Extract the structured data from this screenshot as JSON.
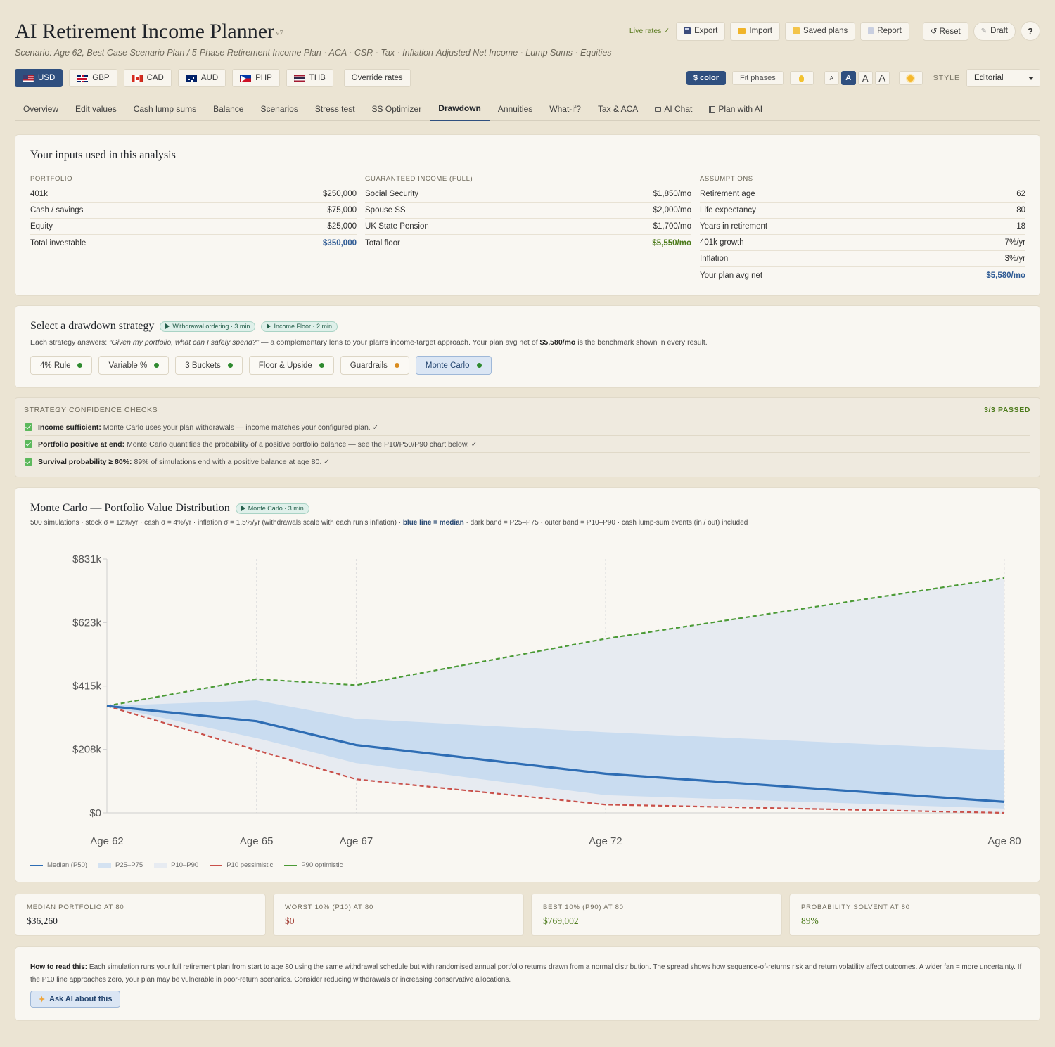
{
  "header": {
    "title": "AI Retirement Income Planner",
    "version": "v7",
    "subtitle": "Scenario: Age 62, Best Case Scenario Plan / 5-Phase Retirement Income Plan · ACA · CSR · Tax · Inflation-Adjusted Net Income · Lump Sums · Equities",
    "live_rates": "Live rates ✓",
    "export_label": "Export",
    "import_label": "Import",
    "saved_plans_label": "Saved plans",
    "report_label": "Report",
    "reset_label": "↺ Reset",
    "draft_label": "Draft",
    "help_label": "?"
  },
  "currencies": [
    {
      "code": "USD",
      "flag": "us"
    },
    {
      "code": "GBP",
      "flag": "gb"
    },
    {
      "code": "CAD",
      "flag": "ca"
    },
    {
      "code": "AUD",
      "flag": "au"
    },
    {
      "code": "PHP",
      "flag": "ph"
    },
    {
      "code": "THB",
      "flag": "th"
    }
  ],
  "override_rates_label": "Override rates",
  "style_controls": {
    "color_label": "$ color",
    "fit_phases_label": "Fit phases",
    "font_sizes": [
      "A",
      "A",
      "A",
      "A"
    ],
    "style_label": "STYLE",
    "style_value": "Editorial"
  },
  "tabs": [
    "Overview",
    "Edit values",
    "Cash lump sums",
    "Balance",
    "Scenarios",
    "Stress test",
    "SS Optimizer",
    "Drawdown",
    "Annuities",
    "What-if?",
    "Tax & ACA",
    "AI Chat",
    "Plan with AI"
  ],
  "inputs": {
    "title": "Your inputs used in this analysis",
    "portfolio": {
      "heading": "PORTFOLIO",
      "rows": [
        {
          "label": "401k",
          "value": "$250,000"
        },
        {
          "label": "Cash / savings",
          "value": "$75,000"
        },
        {
          "label": "Equity",
          "value": "$25,000"
        },
        {
          "label": "Total investable",
          "value": "$350,000"
        }
      ]
    },
    "guaranteed": {
      "heading": "GUARANTEED INCOME (FULL)",
      "rows": [
        {
          "label": "Social Security",
          "value": "$1,850/mo"
        },
        {
          "label": "Spouse SS",
          "value": "$2,000/mo"
        },
        {
          "label": "UK State Pension",
          "value": "$1,700/mo"
        },
        {
          "label": "Total floor",
          "value": "$5,550/mo"
        }
      ]
    },
    "assumptions": {
      "heading": "ASSUMPTIONS",
      "rows": [
        {
          "label": "Retirement age",
          "value": "62"
        },
        {
          "label": "Life expectancy",
          "value": "80"
        },
        {
          "label": "Years in retirement",
          "value": "18"
        },
        {
          "label": "401k growth",
          "value": "7%/yr"
        },
        {
          "label": "Inflation",
          "value": "3%/yr"
        },
        {
          "label": "Your plan avg net",
          "value": "$5,580/mo"
        }
      ]
    }
  },
  "strategy": {
    "title": "Select a drawdown strategy",
    "tag1": "Withdrawal ordering · 3 min",
    "tag2": "Income Floor · 2 min",
    "desc_pre": "Each strategy answers: ",
    "desc_quote": "“Given my portfolio, what can I safely spend?”",
    "desc_mid": " — a complementary lens to your plan's income-target approach. Your plan avg net of ",
    "desc_bold": "$5,580/mo",
    "desc_post": " is the benchmark shown in every result.",
    "options": [
      {
        "label": "4% Rule",
        "status": "green"
      },
      {
        "label": "Variable %",
        "status": "green"
      },
      {
        "label": "3 Buckets",
        "status": "green"
      },
      {
        "label": "Floor & Upside",
        "status": "green"
      },
      {
        "label": "Guardrails",
        "status": "orange"
      },
      {
        "label": "Monte Carlo",
        "status": "green"
      }
    ],
    "selected": "Monte Carlo"
  },
  "checks": {
    "heading": "STRATEGY CONFIDENCE CHECKS",
    "summary": "3/3 PASSED",
    "items": [
      {
        "bold": "Income sufficient:",
        "text": " Monte Carlo uses your plan withdrawals — income matches your configured plan. ✓"
      },
      {
        "bold": "Portfolio positive at end:",
        "text": " Monte Carlo quantifies the probability of a positive portfolio balance — see the P10/P50/P90 chart below. ✓"
      },
      {
        "bold": "Survival probability ≥ 80%:",
        "text": " 89% of simulations end with a positive balance at age 80. ✓"
      }
    ]
  },
  "monte_carlo": {
    "title": "Monte Carlo — Portfolio Value Distribution",
    "tag": "Monte Carlo · 3 min",
    "desc_pre": "500 simulations · stock σ = 12%/yr · cash σ = 4%/yr · inflation σ = 1.5%/yr (withdrawals scale with each run's inflation) · ",
    "desc_bold": "blue line = median",
    "desc_post": " · dark band = P25–P75 · outer band = P10–P90 · cash lump-sum events (in / out) included",
    "legend": [
      "Median (P50)",
      "P25–P75",
      "P10–P90",
      "P10 pessimistic",
      "P90 optimistic"
    ],
    "colors": {
      "median": "#2e6db4",
      "p25_p75": "#c9dcf0",
      "p10_p90": "#e7ebf1",
      "p10": "#c9504a",
      "p90": "#4b9a35"
    }
  },
  "chart_data": {
    "type": "line",
    "x": [
      62,
      65,
      67,
      72,
      80
    ],
    "x_tick_labels": [
      "Age 62",
      "Age 65",
      "Age 67",
      "Age 72",
      "Age 80"
    ],
    "y_tick_labels": [
      "$0",
      "$208k",
      "$415k",
      "$623k",
      "$831k"
    ],
    "y_ticks": [
      0,
      208,
      415,
      623,
      831
    ],
    "ylim": [
      0,
      831
    ],
    "units": "thousands of dollars",
    "series": [
      {
        "name": "Median (P50)",
        "values": [
          350,
          300,
          222,
          128,
          36
        ]
      },
      {
        "name": "P25–P75",
        "lower": [
          350,
          245,
          163,
          58,
          14
        ],
        "upper": [
          350,
          368,
          308,
          264,
          205
        ]
      },
      {
        "name": "P10–P90",
        "lower": [
          350,
          205,
          108,
          28,
          0
        ],
        "upper": [
          350,
          438,
          418,
          570,
          769
        ]
      },
      {
        "name": "P10 pessimistic",
        "values": [
          350,
          205,
          110,
          27,
          0
        ]
      },
      {
        "name": "P90 optimistic",
        "values": [
          350,
          438,
          418,
          570,
          769
        ]
      }
    ],
    "grid": "vertical dashed at x ticks"
  },
  "stats": [
    {
      "label": "MEDIAN PORTFOLIO AT 80",
      "value": "$36,260",
      "color": "#1f2329"
    },
    {
      "label": "WORST 10% (P10) AT 80",
      "value": "$0",
      "color": "#a03a30"
    },
    {
      "label": "BEST 10% (P90) AT 80",
      "value": "$769,002",
      "color": "#4b7a1a"
    },
    {
      "label": "PROBABILITY SOLVENT AT 80",
      "value": "89%",
      "color": "#4b7a1a"
    }
  ],
  "how_to_read": {
    "bold": "How to read this:",
    "text": " Each simulation runs your full retirement plan from start to age 80 using the same withdrawal schedule but with randomised annual portfolio returns drawn from a normal distribution. The spread shows how sequence-of-returns risk and return volatility affect outcomes. A wider fan = more uncertainty. If the P10 line approaches zero, your plan may be vulnerable in poor-return scenarios. Consider reducing withdrawals or increasing conservative allocations.",
    "ask_label": "Ask AI about this"
  }
}
